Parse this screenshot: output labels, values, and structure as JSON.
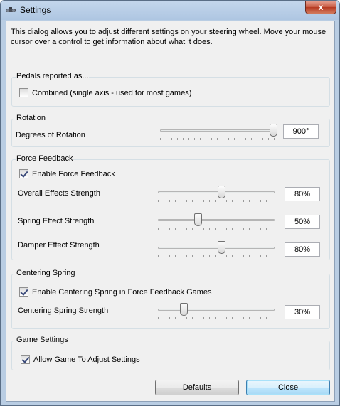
{
  "window": {
    "title": "Settings",
    "close_glyph": "x"
  },
  "intro_text": "This dialog allows you to adjust different settings on your steering wheel.  Move your mouse cursor over a control to get information about what it does.",
  "pedals": {
    "title": "Pedals reported as...",
    "combined_label": "Combined (single axis - used for most games)",
    "combined_checked": false
  },
  "rotation": {
    "title": "Rotation",
    "degrees_label": "Degrees of Rotation",
    "degrees_value": "900°",
    "degrees_level": 0.97
  },
  "force_feedback": {
    "title": "Force Feedback",
    "enable_label": "Enable Force Feedback",
    "enable_checked": true,
    "overall_label": "Overall Effects Strength",
    "overall_value": "80%",
    "overall_level": 0.54,
    "spring_label": "Spring Effect Strength",
    "spring_value": "50%",
    "spring_level": 0.34,
    "damper_label": "Damper Effect Strength",
    "damper_value": "80%",
    "damper_level": 0.54
  },
  "centering_spring": {
    "title": "Centering Spring",
    "enable_label": "Enable Centering Spring in Force Feedback Games",
    "enable_checked": true,
    "strength_label": "Centering Spring Strength",
    "strength_value": "30%",
    "strength_level": 0.22
  },
  "game_settings": {
    "title": "Game Settings",
    "allow_label": "Allow Game To Adjust Settings",
    "allow_checked": true
  },
  "buttons": {
    "defaults": "Defaults",
    "close": "Close"
  },
  "icons": {
    "app": "steering-wheel-icon",
    "close": "close-icon"
  }
}
